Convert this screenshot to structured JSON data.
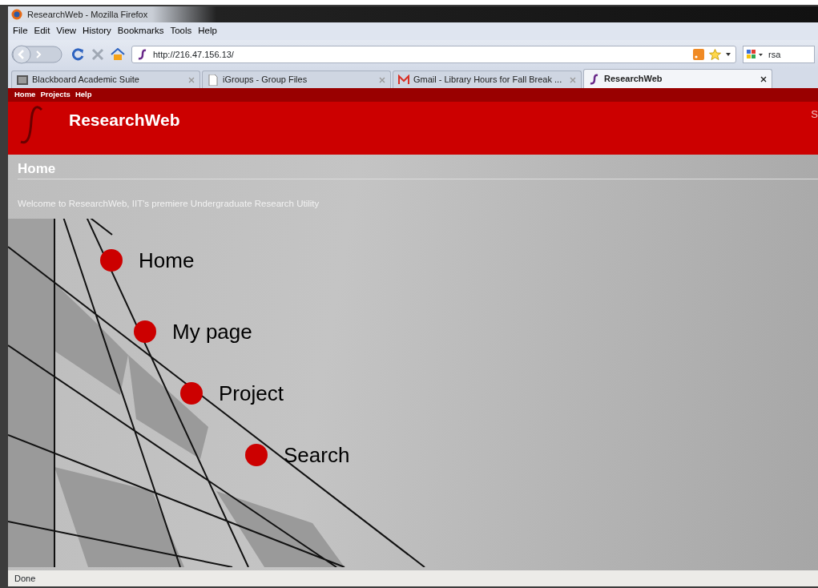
{
  "window": {
    "title": "ResearchWeb - Mozilla Firefox"
  },
  "menu_bar": [
    "File",
    "Edit",
    "View",
    "History",
    "Bookmarks",
    "Tools",
    "Help"
  ],
  "address_bar": {
    "value": "http://216.47.156.13/"
  },
  "search_bar": {
    "value": "rsa"
  },
  "tabs": [
    {
      "label": "Blackboard Academic Suite",
      "selected": false
    },
    {
      "label": "iGroups - Group Files",
      "selected": false
    },
    {
      "label": "Gmail - Library Hours for Fall Break ...",
      "selected": false
    },
    {
      "label": "ResearchWeb",
      "selected": true
    }
  ],
  "site_nav": [
    "Home",
    "Projects",
    "Help"
  ],
  "site_header": {
    "title": "ResearchWeb",
    "right_text": "S"
  },
  "page": {
    "heading": "Home",
    "welcome": "Welcome to ResearchWeb, IIT's premiere Undergraduate Research Utility",
    "links": [
      "Home",
      "My page",
      "Project",
      "Search"
    ]
  },
  "status_bar": {
    "text": "Done"
  }
}
